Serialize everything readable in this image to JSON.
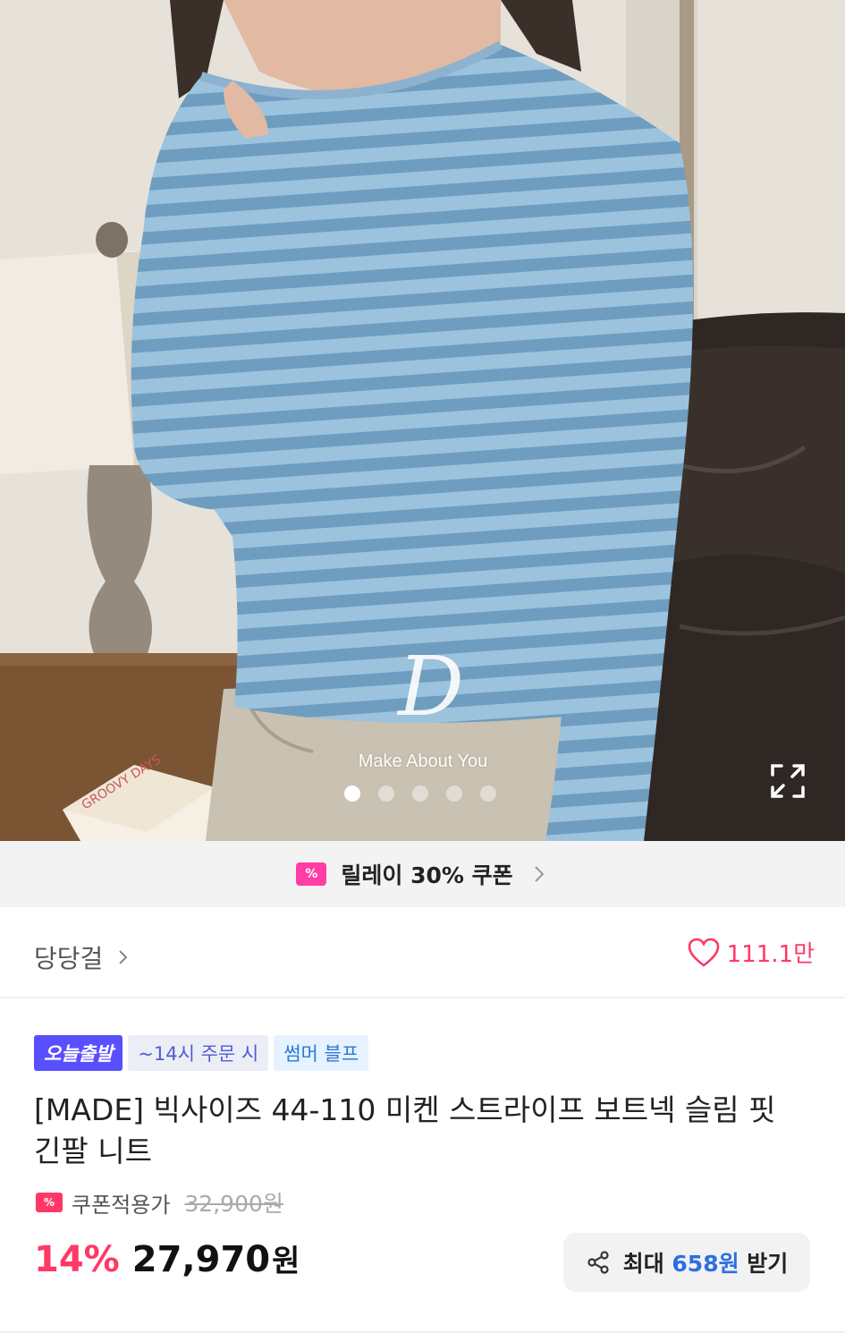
{
  "photo": {
    "watermark_monogram": "D",
    "watermark_text": "Make About You",
    "book_text": "GROOVY DAYS",
    "carousel": {
      "total": 5,
      "active_index": 0
    }
  },
  "coupon_banner": {
    "label": "릴레이 30% 쿠폰",
    "icon": "percent-coupon-icon"
  },
  "store": {
    "name": "당당걸",
    "likes": "111.1만"
  },
  "badges": [
    {
      "label": "오늘출발"
    },
    {
      "label": "~14시 주문 시"
    },
    {
      "label": "썸머 블프"
    }
  ],
  "product": {
    "title": "[MADE] 빅사이즈 44-110 미켄 스트라이프 보트넥 슬림 핏 긴팔 니트",
    "coupon_label": "쿠폰적용가",
    "original_price": "32,900원",
    "discount": "14%",
    "price": "27,970",
    "currency": "원"
  },
  "share": {
    "prefix": "최대 ",
    "amount": "658원",
    "suffix": " 받기"
  },
  "colors": {
    "accent_pink": "#ff3866",
    "coupon_pink": "#ff3da5",
    "badge_purple": "#5a4fff",
    "link_blue": "#2c6fe0"
  }
}
